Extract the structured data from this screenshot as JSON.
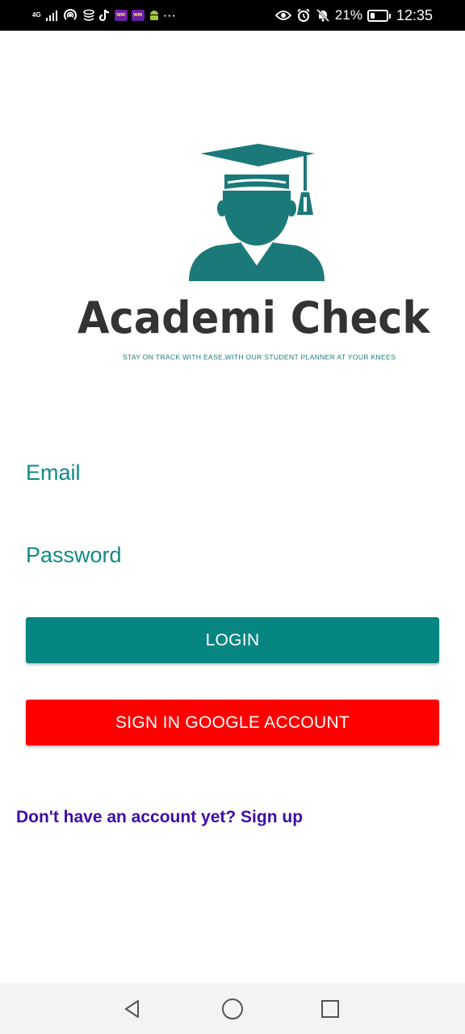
{
  "status_bar": {
    "network_label": "4G",
    "mini_app_label": "ww",
    "more_indicator": "···",
    "battery_percent": "21%",
    "time": "12:35",
    "icons": [
      "signal-icon",
      "hotspot-icon",
      "data-stack-icon",
      "tiktok-icon",
      "app-icon",
      "app-icon",
      "android-icon",
      "eye-icon",
      "alarm-icon",
      "notification-muted-icon",
      "battery-icon"
    ]
  },
  "logo": {
    "title": "Academi Check",
    "tagline": "STAY ON TRACK WITH EASE,WITH OUR STUDENT PLANNER AT YOUR KNEES",
    "icon": "graduate-icon"
  },
  "form": {
    "email_placeholder": "Email",
    "password_placeholder": "Password",
    "email_value": "",
    "password_value": ""
  },
  "buttons": {
    "login_label": "LOGIN",
    "google_label": "SIGN IN GOOGLE ACCOUNT"
  },
  "signup": {
    "label": "Don't have an account yet? Sign up"
  },
  "colors": {
    "primary": "#078581",
    "google_button": "#ff0000",
    "link": "#3d0ea8",
    "label": "#0f8a86",
    "logo_text": "#333333"
  },
  "nav": {
    "icons": [
      "back-icon",
      "home-icon",
      "recents-icon"
    ]
  }
}
